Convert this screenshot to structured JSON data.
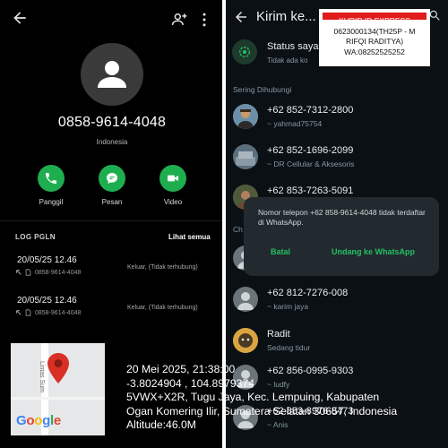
{
  "contact": {
    "phone": "0858-9614-4048",
    "country": "Indonesia",
    "actions": {
      "call": "Panggil",
      "message": "Pesan",
      "video": "Video"
    },
    "log": {
      "title": "LOG PGLN",
      "see_all": "Lihat semua",
      "items": [
        {
          "datetime": "20/05/25 12.46",
          "number": "0858-9614-4048",
          "status": "Keluar, (Tidak terhubung)"
        },
        {
          "datetime": "20/05/25 12.46",
          "number": "0858-9614-4048",
          "status": "Keluar, (Tidak terhubung)"
        }
      ]
    }
  },
  "whatsapp": {
    "title": "Kirim ke...",
    "status": {
      "title": "Status saya",
      "subtitle": "Tidak ada ko"
    },
    "frequent_header": "Sering Dihubungi",
    "other_header": "Ch",
    "contacts": [
      {
        "name": "+62 852-7312-2800",
        "sub": "~ yahmad75754"
      },
      {
        "name": "+62 852-1696-2099",
        "sub": "~ DR Cellular & Aksesoris"
      },
      {
        "name": "+62 853-7263-5091",
        "sub": ""
      },
      {
        "name": "+62 812-7276-008",
        "sub": "~ karim jaya"
      },
      {
        "name": "Radit",
        "sub": "Sedang tidur"
      },
      {
        "name": "+62 856-0995-9303",
        "sub": "~ ludfy"
      },
      {
        "name": "+62 853-8976-8473",
        "sub": "~ Anis"
      }
    ],
    "dialog": {
      "message": "Nomor telepon +62 858-9614-4048 tidak terdaftar di WhatsApp.",
      "cancel": "Batal",
      "invite": "Undang ke WhatsApp"
    }
  },
  "sticker": {
    "line1": "KURIR ID EXPRESS",
    "line2": "0623000134(TH25P - M",
    "line3": "RIFQI RADITYA)",
    "line4": "WA:08252525252"
  },
  "map": {
    "street": "Lintas Sum",
    "logo": "Google"
  },
  "overlay": {
    "line1": "20 Mei 2025, 21:38:00",
    "line2": "-3.8024904 , 104.8979374",
    "line3": "5VWX+X2R, Tugu Jaya, Kec. Lempuing, Kabupaten",
    "line4": "Ogan Komering Ilir, Sumatera Selatan 30657, Indonesia",
    "line5": "Altitude:46.0M"
  },
  "colors": {
    "accent_green": "#1fae4f",
    "wa_green": "#21c063",
    "sticker_red": "#e21b1b"
  }
}
